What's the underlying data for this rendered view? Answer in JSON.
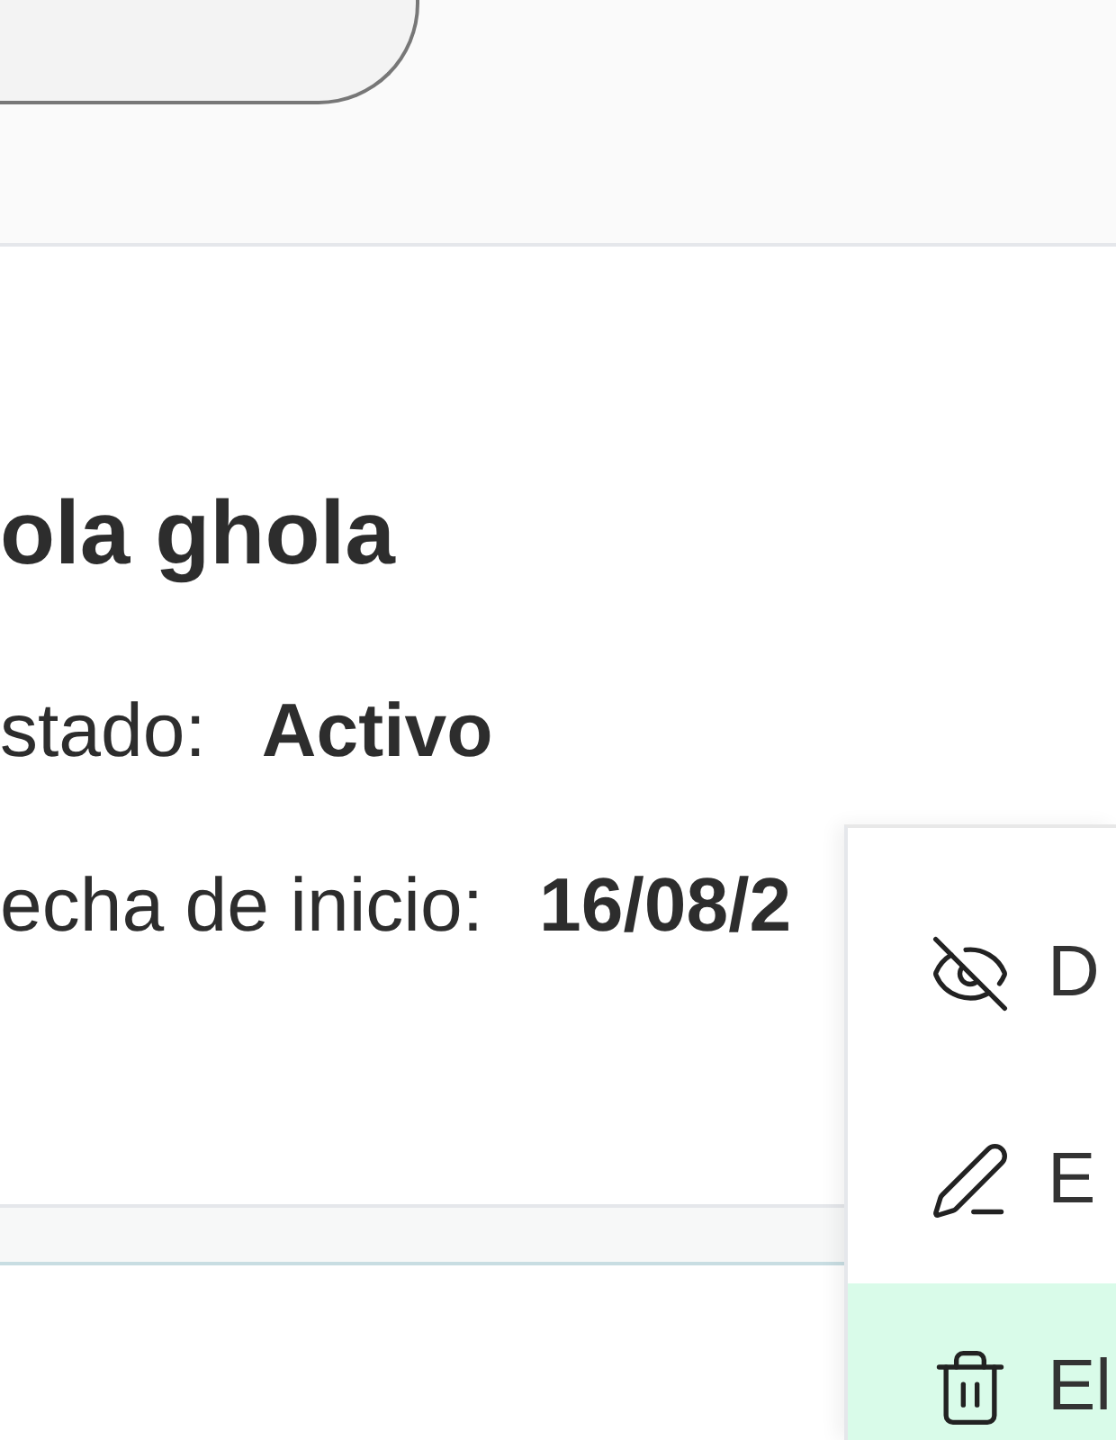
{
  "record": {
    "title": "ola ghola",
    "fields": [
      {
        "label": "stado:",
        "value": "Activo"
      },
      {
        "label": "echa de inicio:",
        "value": "16/08/2"
      }
    ]
  },
  "context_menu": {
    "items": [
      {
        "kind": "hide",
        "label": "D",
        "selected": false
      },
      {
        "kind": "edit",
        "label": "E",
        "selected": false
      },
      {
        "kind": "delete",
        "label": "El",
        "selected": true
      }
    ]
  }
}
